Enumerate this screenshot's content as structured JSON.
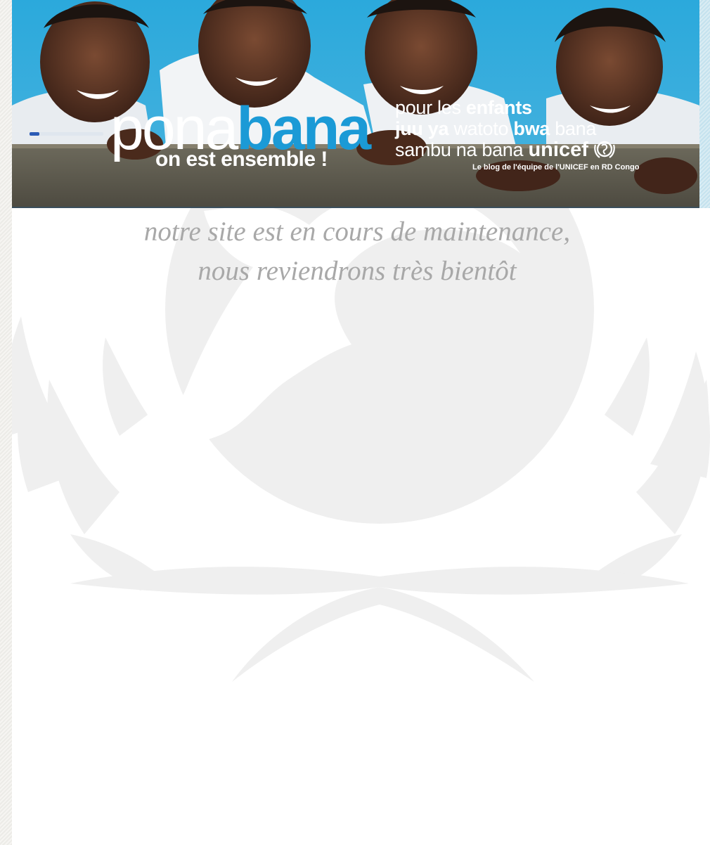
{
  "banner": {
    "logo": {
      "part1": "po",
      "part2": "na",
      "part3": "bana",
      "tagline": "on est ensemble !"
    },
    "lines": {
      "l1_a": "pour les ",
      "l1_b": "enfants",
      "l2_a": "juu ya ",
      "l2_b": "watoto ",
      "l2_c": "bwa",
      "l2_d": " bana",
      "l3_a": "sambu na bana ",
      "l3_b": "unicef"
    },
    "blog_caption": "Le blog de l'équipe de l'UNICEF en RD Congo"
  },
  "message": {
    "line1": "notre site est en cours de maintenance,",
    "line2": "nous reviendrons très bientôt"
  },
  "colors": {
    "accent_blue": "#1b9ad6",
    "message_grey": "#a8a8a8",
    "watermark_grey": "#efefef"
  },
  "icons": {
    "watermark": "unicef-emblem-icon",
    "logo": "unicef-emblem-icon"
  }
}
